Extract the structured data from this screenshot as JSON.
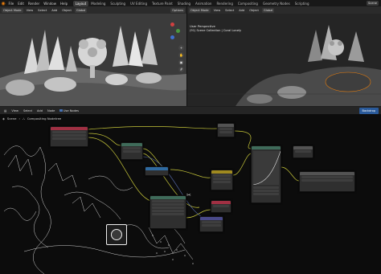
{
  "topbar": {
    "menus": [
      "File",
      "Edit",
      "Render",
      "Window",
      "Help"
    ],
    "workspaces": [
      {
        "label": "Layout",
        "active": true
      },
      {
        "label": "Modeling",
        "active": false
      },
      {
        "label": "Sculpting",
        "active": false
      },
      {
        "label": "UV Editing",
        "active": false
      },
      {
        "label": "Texture Paint",
        "active": false
      },
      {
        "label": "Shading",
        "active": false
      },
      {
        "label": "Animation",
        "active": false
      },
      {
        "label": "Rendering",
        "active": false
      },
      {
        "label": "Compositing",
        "active": false
      },
      {
        "label": "Geometry Nodes",
        "active": false
      },
      {
        "label": "Scripting",
        "active": false
      }
    ],
    "scene_name": "Scene"
  },
  "viewport_left": {
    "mode": "Object Mode",
    "menus": [
      "View",
      "Select",
      "Add",
      "Object"
    ],
    "orientation": "Global",
    "options_label": "Options"
  },
  "viewport_right": {
    "mode": "Object Mode",
    "menus": [
      "View",
      "Select",
      "Add",
      "Object"
    ],
    "orientation": "Global",
    "perspective_label": "User Perspective",
    "collection_label": "(91) Scene Collection | Coral Lonely"
  },
  "node_editor": {
    "menus": [
      "View",
      "Select",
      "Add",
      "Node"
    ],
    "use_nodes_label": "Use Nodes",
    "backdrop_label": "Backdrop",
    "breadcrumb": [
      "Scene",
      "Compositing Nodetree"
    ]
  },
  "colors": {
    "accent": "#e87d0d",
    "node_render": "#a03043",
    "node_color": "#3f6b5a",
    "node_converter": "#2f6aa0",
    "node_output": "#535353",
    "link": "#c8c83a"
  }
}
